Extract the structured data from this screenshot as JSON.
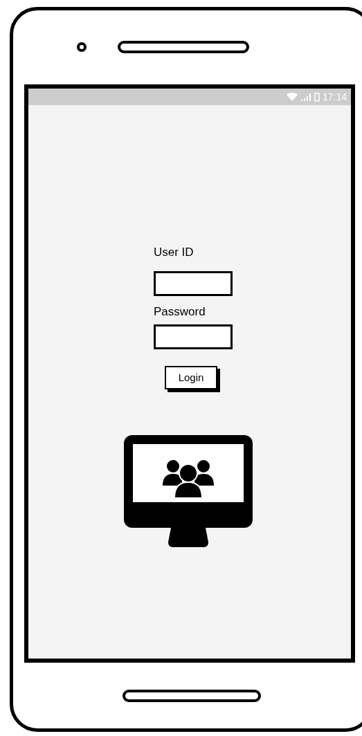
{
  "status_bar": {
    "time": "17:14"
  },
  "form": {
    "fields": [
      {
        "label": "User ID"
      },
      {
        "label": "Password"
      }
    ],
    "button": "Login"
  }
}
